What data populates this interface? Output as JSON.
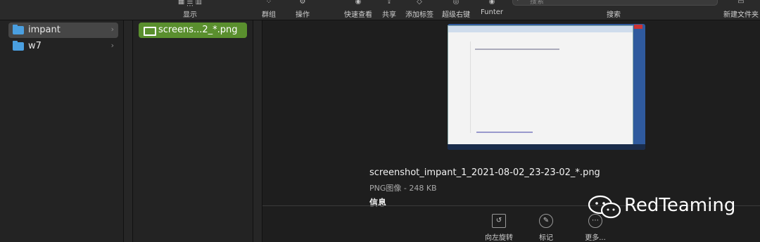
{
  "toolbar": {
    "display_label": "显示",
    "group_label": "群组",
    "action_label": "操作",
    "quicklook_label": "快速查看",
    "share_label": "共享",
    "add_tag_label": "添加标签",
    "super_right_label": "超级右键",
    "funter_label": "Funter",
    "search_label": "搜索",
    "search_placeholder": "搜索",
    "new_folder_label": "新建文件夹"
  },
  "column1": {
    "items": [
      {
        "label": "impant",
        "selected": true
      },
      {
        "label": "w7",
        "selected": false
      }
    ]
  },
  "column2": {
    "items": [
      {
        "label": "screens...2_*.png",
        "selected": true
      }
    ]
  },
  "preview": {
    "file_name": "screenshot_impant_1_2021-08-02_23-23-02_*.png",
    "file_meta": "PNG图像 - 248 KB",
    "info_header": "信息"
  },
  "actions": {
    "rotate_left": "向左旋转",
    "markup": "标记",
    "more": "更多..."
  },
  "watermark": {
    "text": "RedTeaming"
  },
  "colors": {
    "selected_file_bg": "#5a8f2e",
    "folder": "#4a9fe0"
  }
}
